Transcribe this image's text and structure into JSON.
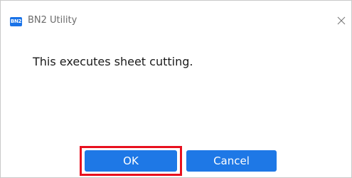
{
  "window": {
    "title": "BN2 Utility",
    "icon": {
      "name": "bn2-app-icon",
      "text": "BN2",
      "color": "#1a73e8"
    },
    "close_icon": "close-icon"
  },
  "dialog": {
    "message": "This executes sheet cutting."
  },
  "buttons": {
    "ok_label": "OK",
    "cancel_label": "Cancel",
    "color": "#1e78e6",
    "ok_highlight_color": "#e8101e"
  }
}
